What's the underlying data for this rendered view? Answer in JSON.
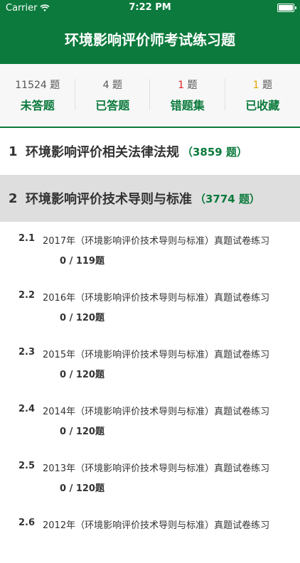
{
  "status": {
    "carrier": "Carrier",
    "time": "7:22 PM"
  },
  "nav": {
    "title": "环境影响评价师考试练习题"
  },
  "stats": [
    {
      "count": "11524",
      "unit": "题",
      "label": "未答题"
    },
    {
      "count": "4",
      "unit": "题",
      "label": "已答题"
    },
    {
      "count": "1",
      "unit": "题",
      "label": "错题集"
    },
    {
      "count": "1",
      "unit": "题",
      "label": "已收藏"
    }
  ],
  "sections": [
    {
      "idx": "1",
      "title": "环境影响评价相关法律法规",
      "count": "（3859 题）"
    },
    {
      "idx": "2",
      "title": "环境影响评价技术导则与标准",
      "count": "（3774 题）"
    }
  ],
  "items": [
    {
      "num": "2.1",
      "text": "2017年（环境影响评价技术导则与标准）真题试卷练习",
      "progress": "0 / 119题"
    },
    {
      "num": "2.2",
      "text": "2016年（环境影响评价技术导则与标准）真题试卷练习",
      "progress": "0 / 120题"
    },
    {
      "num": "2.3",
      "text": "2015年（环境影响评价技术导则与标准）真题试卷练习",
      "progress": "0 / 120题"
    },
    {
      "num": "2.4",
      "text": "2014年（环境影响评价技术导则与标准）真题试卷练习",
      "progress": "0 / 120题"
    },
    {
      "num": "2.5",
      "text": "2013年（环境影响评价技术导则与标准）真题试卷练习",
      "progress": "0 / 120题"
    },
    {
      "num": "2.6",
      "text": "2012年（环境影响评价技术导则与标准）真题试卷练习",
      "progress": ""
    }
  ]
}
